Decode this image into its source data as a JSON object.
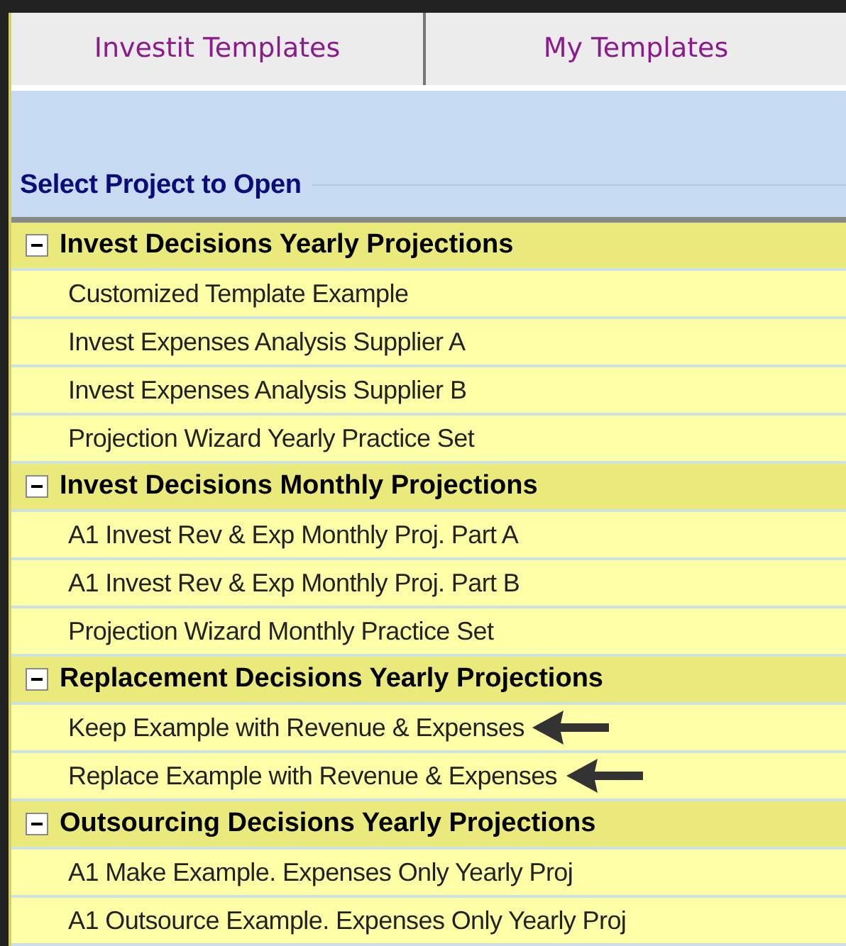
{
  "tabs": [
    {
      "label": "Investit Templates"
    },
    {
      "label": "My Templates"
    }
  ],
  "panel_title": "Select Project to Open",
  "groups": [
    {
      "title": "Invest Decisions Yearly Projections",
      "expanded": true,
      "items": [
        {
          "label": "Customized Template Example",
          "arrow": false
        },
        {
          "label": "Invest Expenses Analysis Supplier A",
          "arrow": false
        },
        {
          "label": "Invest Expenses Analysis Supplier B",
          "arrow": false
        },
        {
          "label": "Projection Wizard Yearly Practice Set",
          "arrow": false
        }
      ]
    },
    {
      "title": "Invest Decisions Monthly Projections",
      "expanded": true,
      "items": [
        {
          "label": "A1 Invest Rev & Exp Monthly Proj. Part A",
          "arrow": false
        },
        {
          "label": "A1 Invest Rev & Exp Monthly Proj. Part B",
          "arrow": false
        },
        {
          "label": "Projection Wizard Monthly Practice Set",
          "arrow": false
        }
      ]
    },
    {
      "title": "Replacement Decisions Yearly Projections",
      "expanded": true,
      "items": [
        {
          "label": "Keep Example with Revenue & Expenses",
          "arrow": true
        },
        {
          "label": "Replace Example with Revenue & Expenses",
          "arrow": true
        }
      ]
    },
    {
      "title": "Outsourcing Decisions Yearly Projections",
      "expanded": true,
      "items": [
        {
          "label": "A1 Make Example. Expenses Only Yearly Proj",
          "arrow": false
        },
        {
          "label": "A1 Outsource Example. Expenses Only Yearly Proj",
          "arrow": false
        }
      ]
    }
  ]
}
